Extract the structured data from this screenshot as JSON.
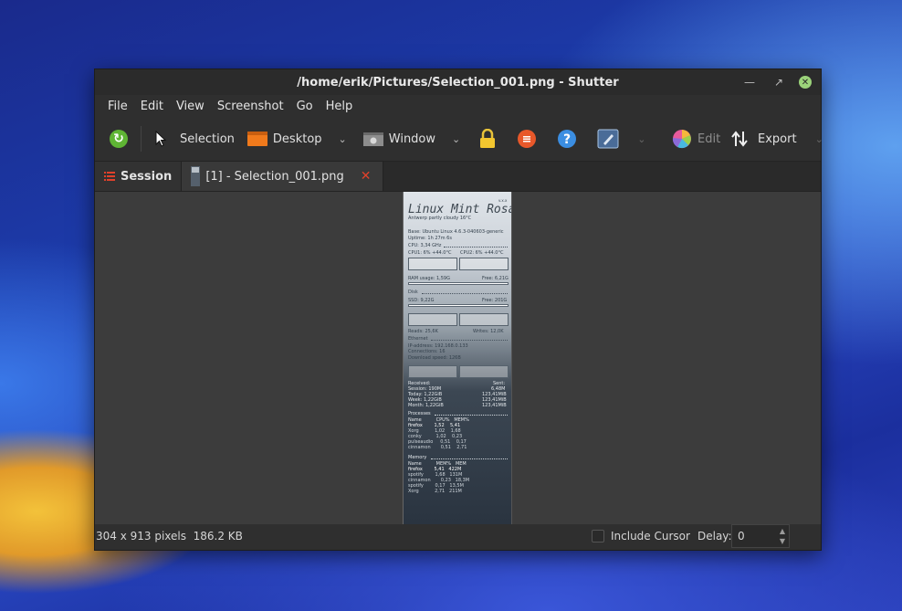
{
  "window": {
    "title": "/home/erik/Pictures/Selection_001.png - Shutter",
    "controls": [
      "minimize",
      "maximize",
      "close"
    ]
  },
  "menubar": {
    "items": [
      "File",
      "Edit",
      "View",
      "Screenshot",
      "Go",
      "Help"
    ]
  },
  "toolbar": {
    "selection_label": "Selection",
    "desktop_label": "Desktop",
    "window_label": "Window",
    "edit_label": "Edit",
    "export_label": "Export"
  },
  "tabs": {
    "session_label": "Session",
    "file_label": "[1] - Selection_001.png"
  },
  "preview": {
    "title": "Linux Mint Rosa",
    "version": "v.x.x",
    "weather": "Antwerp partly cloudy 16°C",
    "base": "Base: Ubuntu Linux 4.6.3-040603-generic",
    "uptime": "Uptime: 1h 27m 6s",
    "cpu_header": "CPU: 3,34 GHz",
    "cpu1": "CPU1: 6%    +44.0°C",
    "cpu2": "CPU2: 6%    +44.0°C",
    "ram_usage": "RAM usage: 1,59G",
    "ram_free": "Free: 6,21G",
    "disk_header": "Disk",
    "ssd": "SSD: 9,22G",
    "ssd_free": "Free: 201G",
    "reads": "Reads: 25,6K",
    "writes": "Writes: 12,0K",
    "ethernet_header": "Ethernet",
    "ip": "IP-address: 192.168.0.133",
    "connections": "Connections: 16",
    "download": "Download speed: 126B",
    "received": "Received:",
    "sent": "Sent:",
    "session": "Session: 190M",
    "session_sent": "6,48M",
    "today": "Today:   1,22GiB",
    "today_sent": "123,41MiB",
    "week": "Week:    1,22GiB",
    "week_sent": "123,41MiB",
    "month": "Month:   1,22GiB",
    "month_sent": "123,41MiB",
    "processes_header": "Processes",
    "proc_cols": "Name          CPU%   MEM%",
    "proc_rows": [
      "firefox        1,52    5,41",
      "Xorg           1,02    1,68",
      "conky          1,02    0,23",
      "pulseaudio     0,51    0,17",
      "cinnamon       0,51    2,71"
    ],
    "memory_header": "Memory",
    "mem_cols": "Name          MEM%   MEM",
    "mem_rows": [
      "firefox        5,41   422M",
      "spotify        1,68   131M",
      "cinnamon       0,23   18,3M",
      "spotify        0,17   13,5M",
      "Xorg           2,71   211M"
    ]
  },
  "statusbar": {
    "image_info": "304 x 913 pixels  186.2 KB",
    "include_cursor_label": "Include Cursor",
    "delay_label": "Delay:",
    "delay_value": "0"
  }
}
